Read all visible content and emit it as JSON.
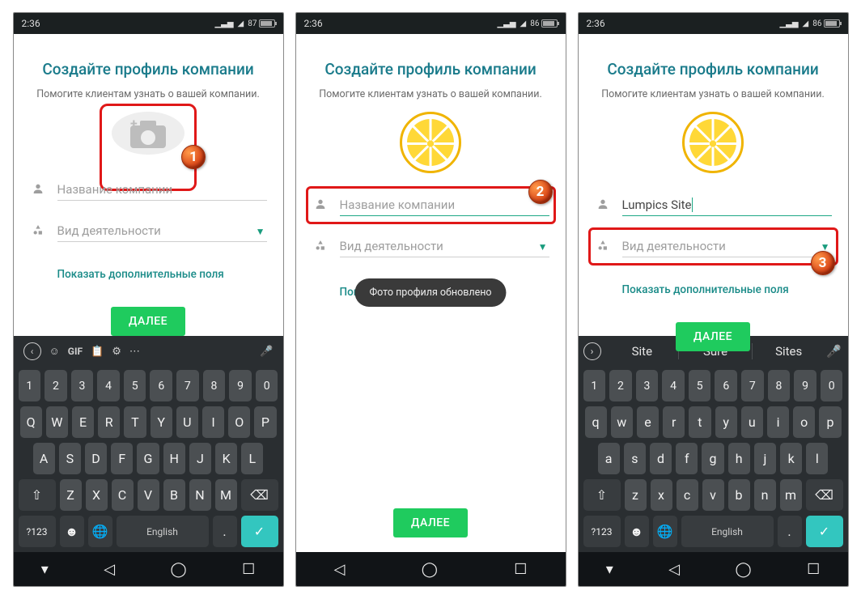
{
  "status": {
    "time": "2:36",
    "battery": [
      87,
      86,
      86
    ]
  },
  "screen": {
    "title": "Создайте профиль компании",
    "subtitle": "Помогите клиентам узнать о вашей компании.",
    "company_name_placeholder": "Название компании",
    "activity_placeholder": "Вид деятельности",
    "show_more": "Показать дополнительные поля",
    "next_button": "ДАЛЕЕ",
    "toast_photo_updated": "Фото профиля обновлено",
    "company_name_value_s3": "Lumpics Site"
  },
  "callouts": {
    "c1": "1",
    "c2": "2",
    "c3": "3"
  },
  "keyboard": {
    "toolbar": {
      "gif": "GIF"
    },
    "suggestions": [
      "Site",
      "Sure",
      "Sites"
    ],
    "row_num": [
      "1",
      "2",
      "3",
      "4",
      "5",
      "6",
      "7",
      "8",
      "9",
      "0"
    ],
    "row_q_upper": [
      "Q",
      "W",
      "E",
      "R",
      "T",
      "Y",
      "U",
      "I",
      "O",
      "P"
    ],
    "row_q_lower": [
      "q",
      "w",
      "e",
      "r",
      "t",
      "y",
      "u",
      "i",
      "o",
      "p"
    ],
    "row_a_upper": [
      "A",
      "S",
      "D",
      "F",
      "G",
      "H",
      "J",
      "K",
      "L"
    ],
    "row_a_lower": [
      "a",
      "s",
      "d",
      "f",
      "g",
      "h",
      "j",
      "k",
      "l"
    ],
    "row_z_upper": [
      "Z",
      "X",
      "C",
      "V",
      "B",
      "N",
      "M"
    ],
    "row_z_lower": [
      "z",
      "x",
      "c",
      "v",
      "b",
      "n",
      "m"
    ],
    "sym_key": "?123",
    "lang_key": "English"
  }
}
